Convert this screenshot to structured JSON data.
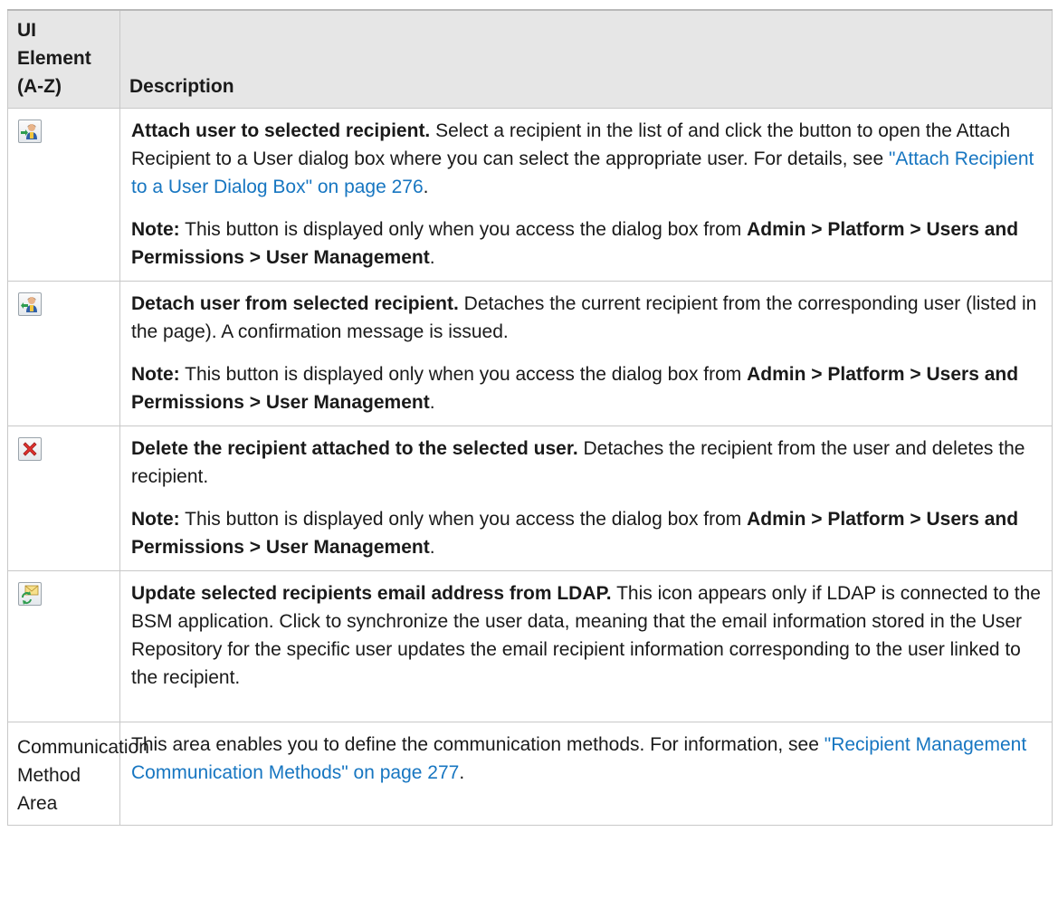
{
  "header": {
    "col1": "UI Element (A-Z)",
    "col2": "Description"
  },
  "rows": [
    {
      "icon": "attach-user-icon",
      "title": "Attach user to selected recipient.",
      "text": " Select a recipient in the list of and click the button to open the Attach Recipient to a User dialog box where you can select the appropriate user. For details, see ",
      "link": "\"Attach Recipient to a User Dialog Box\" on page 276",
      "after": ".",
      "note_label": "Note:",
      "note_text": " This button is displayed only when you access the dialog box from ",
      "note_path": "Admin > Platform > Users and Permissions > User Management",
      "note_end": "."
    },
    {
      "icon": "detach-user-icon",
      "title": "Detach user from selected recipient.",
      "text": " Detaches the current recipient from the corresponding user (listed in the page). A confirmation message is issued.",
      "note_label": "Note:",
      "note_text": " This button is displayed only when you access the dialog box from ",
      "note_path": "Admin > Platform > Users and Permissions > User Management",
      "note_end": "."
    },
    {
      "icon": "delete-icon",
      "title": "Delete the recipient attached to the selected user.",
      "text": " Detaches the recipient from the user and deletes the recipient.",
      "note_label": "Note:",
      "note_text": " This button is displayed only when you access the dialog box from ",
      "note_path": "Admin > Platform > Users and Permissions > User Management",
      "note_end": "."
    },
    {
      "icon": "ldap-sync-email-icon",
      "title": "Update selected recipients email address from LDAP.",
      "text": " This icon appears only if LDAP is connected to the BSM application. Click to synchronize the user data, meaning that the email information stored in the User Repository for the specific user updates the email recipient information corresponding to the user linked to the recipient."
    },
    {
      "element_text": "Communication Method Area",
      "text": "This area enables you to define the communication methods. For information, see ",
      "link": "\"Recipient Management Communication Methods\" on page 277",
      "after": "."
    }
  ]
}
